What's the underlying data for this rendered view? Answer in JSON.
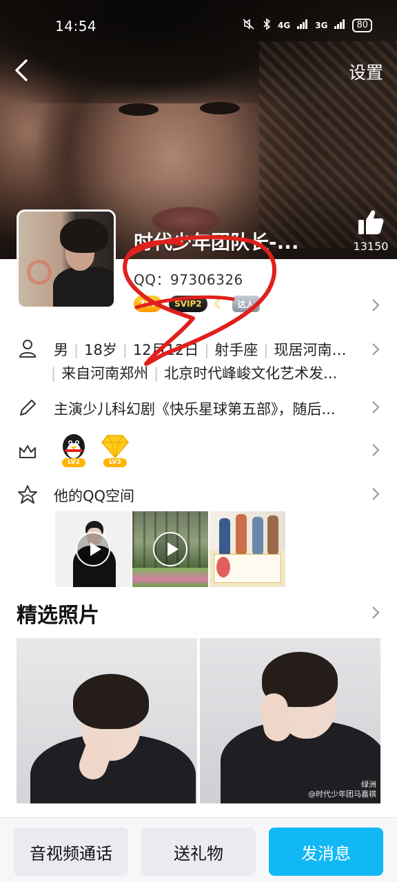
{
  "status_bar": {
    "time": "14:54",
    "network_1": "4G",
    "network_2": "3G",
    "battery": "80"
  },
  "header": {
    "settings_label": "设置",
    "profile_name": "时代少年团队长-...",
    "like_count": "13150"
  },
  "profile": {
    "qq_number": "QQ：97306326",
    "badges": [
      {
        "label": "707",
        "type": "vip-level"
      },
      {
        "label": "SVIP2",
        "type": "svip"
      },
      {
        "label": "",
        "type": "moon"
      },
      {
        "label": "达人",
        "type": "talent"
      }
    ]
  },
  "info_rows": {
    "basic_line1": [
      "男",
      "18岁",
      "12月12日",
      "射手座",
      "现居河南郑州"
    ],
    "basic_line2": [
      "来自河南郑州",
      "北京时代峰峻文化艺术发..."
    ],
    "signature": "主演少儿科幻剧《快乐星球第五部》，随后...",
    "level_badges": [
      "LV2",
      "LV3"
    ],
    "qzone_label": "他的QQ空间"
  },
  "photos": {
    "section_title": "精选照片",
    "watermark_line1": "绿洲",
    "watermark_line2": "@时代少年团马嘉祺"
  },
  "bottom_bar": {
    "call_label": "音视频通话",
    "gift_label": "送礼物",
    "message_label": "发消息"
  },
  "colors": {
    "accent_blue": "#12b7f5",
    "annotation_red": "#e0201c",
    "button_gray": "#e9ebf0"
  }
}
